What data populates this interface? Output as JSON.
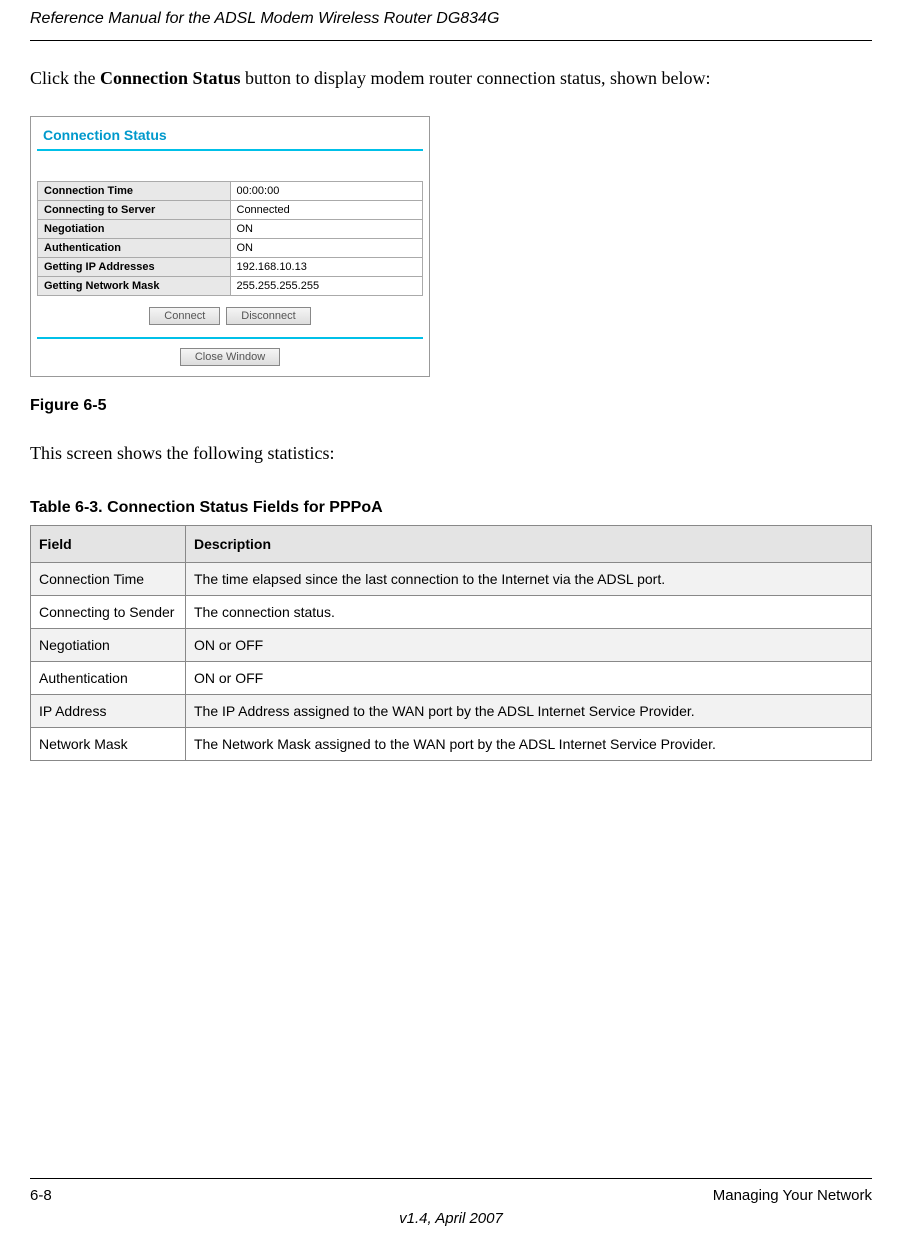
{
  "header": {
    "title": "Reference Manual for the ADSL Modem Wireless Router DG834G"
  },
  "intro": {
    "prefix": "Click the ",
    "bold": "Connection Status",
    "suffix": " button to display modem router connection status, shown below:"
  },
  "screenshot": {
    "title": "Connection Status",
    "rows": [
      {
        "label": "Connection Time",
        "value": "00:00:00"
      },
      {
        "label": "Connecting to Server",
        "value": "Connected"
      },
      {
        "label": "Negotiation",
        "value": "ON"
      },
      {
        "label": "Authentication",
        "value": "ON"
      },
      {
        "label": "Getting IP Addresses",
        "value": "192.168.10.13"
      },
      {
        "label": "Getting Network Mask",
        "value": "255.255.255.255"
      }
    ],
    "buttons": {
      "connect": "Connect",
      "disconnect": "Disconnect",
      "close": "Close Window"
    }
  },
  "figure_caption": "Figure 6-5",
  "body_text": "This screen shows the following statistics:",
  "table_caption": "Table 6-3. Connection Status Fields for PPPoA",
  "table": {
    "headers": {
      "field": "Field",
      "description": "Description"
    },
    "rows": [
      {
        "field": "Connection Time",
        "description": "The time elapsed since the last connection to the Internet via the ADSL port."
      },
      {
        "field": "Connecting to Sender",
        "description": "The connection status."
      },
      {
        "field": "Negotiation",
        "description": "ON or OFF"
      },
      {
        "field": "Authentication",
        "description": "ON or OFF"
      },
      {
        "field": "IP Address",
        "description": "The IP Address assigned to the WAN port by the ADSL Internet Service Provider."
      },
      {
        "field": "Network Mask",
        "description": "The Network Mask assigned to the WAN port by the ADSL Internet Service Provider."
      }
    ]
  },
  "footer": {
    "page": "6-8",
    "section": "Managing Your Network",
    "version": "v1.4, April 2007"
  }
}
